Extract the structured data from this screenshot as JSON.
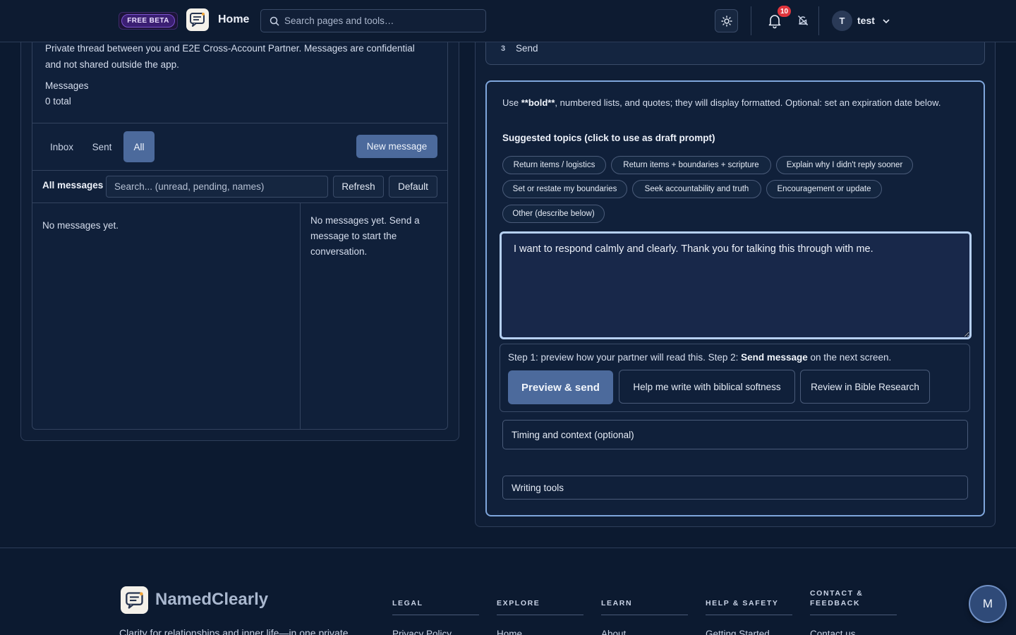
{
  "header": {
    "beta_badge": "FREE BETA",
    "home_label": "Home",
    "search_placeholder": "Search pages and tools…",
    "notification_count": "10",
    "user_initial": "T",
    "user_name": "test"
  },
  "thread": {
    "description": "Private thread between you and E2E Cross-Account Partner. Messages are confidential and not shared outside the app.",
    "messages_label": "Messages",
    "messages_count": "0 total",
    "tabs": [
      "Inbox",
      "Sent",
      "All"
    ],
    "active_tab": "All",
    "new_message_label": "New message",
    "list_label": "All messages",
    "search_placeholder": "Search... (unread, pending, names)",
    "refresh_label": "Refresh",
    "default_label": "Default",
    "empty_list": "No messages yet.",
    "empty_thread": "No messages yet. Send a message to start the conversation."
  },
  "compose": {
    "step_number": "3",
    "step_label": "Send",
    "hint_prefix": "Use ",
    "hint_bold": "**bold**",
    "hint_suffix": ", numbered lists, and quotes; they will display formatted. Optional: set an expiration date below.",
    "topics_title": "Suggested topics (click to use as draft prompt)",
    "topics": [
      "Return items / logistics",
      "Return items + boundaries + scripture",
      "Explain why I didn't reply sooner",
      "Set or restate my boundaries",
      "Seek accountability and truth",
      "Encouragement or update",
      "Other (describe below)"
    ],
    "draft_text": "I want to respond calmly and clearly. Thank you for talking this through with me.",
    "preview_prefix": "Step 1: preview how your partner will read this. Step 2: ",
    "preview_bold": "Send message",
    "preview_suffix": " on the next screen.",
    "preview_send_label": "Preview & send",
    "help_write_label": "Help me write with biblical softness",
    "review_label": "Review in Bible Research",
    "timing_label": "Timing and context (optional)",
    "writing_tools_label": "Writing tools"
  },
  "footer": {
    "brand": "NamedClearly",
    "tagline": "Clarity for relationships and inner life—in one private",
    "columns": [
      {
        "title_line1": "LEGAL",
        "title_line2": "",
        "first_link": "Privacy Policy"
      },
      {
        "title_line1": "EXPLORE",
        "title_line2": "",
        "first_link": "Home"
      },
      {
        "title_line1": "LEARN",
        "title_line2": "",
        "first_link": "About"
      },
      {
        "title_line1": "HELP & SAFETY",
        "title_line2": "",
        "first_link": "Getting Started"
      },
      {
        "title_line1": "CONTACT &",
        "title_line2": "FEEDBACK",
        "first_link": "Contact us"
      }
    ],
    "fab_label": "M"
  },
  "colors": {
    "background": "#0c1a30",
    "accent": "#4c6a9c",
    "focus_ring": "#b6d0f3",
    "badge": "#e0353d"
  }
}
